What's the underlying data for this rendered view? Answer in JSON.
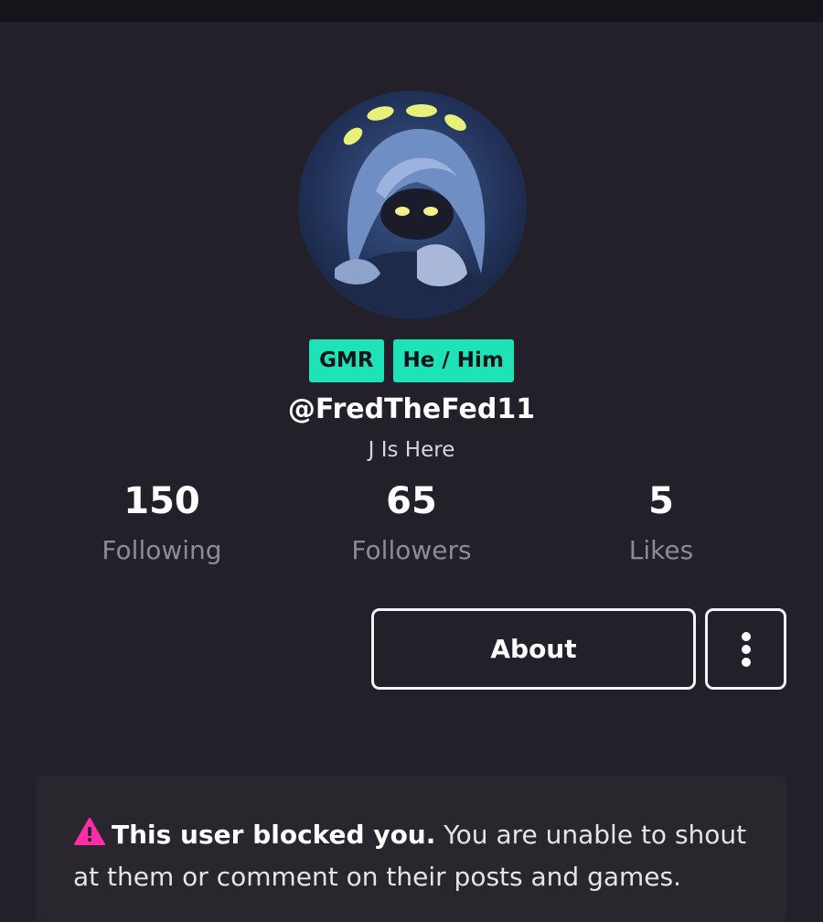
{
  "profile": {
    "badges": [
      "GMR",
      "He / Him"
    ],
    "username": "@FredTheFed11",
    "bio": "J Is Here",
    "stats": [
      {
        "value": "150",
        "label": "Following"
      },
      {
        "value": "65",
        "label": "Followers"
      },
      {
        "value": "5",
        "label": "Likes"
      }
    ],
    "about_label": "About",
    "more_icon": "more-vertical-icon",
    "avatar_icon": "avatar-image"
  },
  "notice": {
    "icon": "warning-icon",
    "bold": "This user blocked you.",
    "text": " You are unable to shout at them or comment on their posts and games."
  },
  "colors": {
    "background": "#232029",
    "badge": "#1fe3b8",
    "warning": "#ff2ea6",
    "muted": "#8e8b93"
  }
}
